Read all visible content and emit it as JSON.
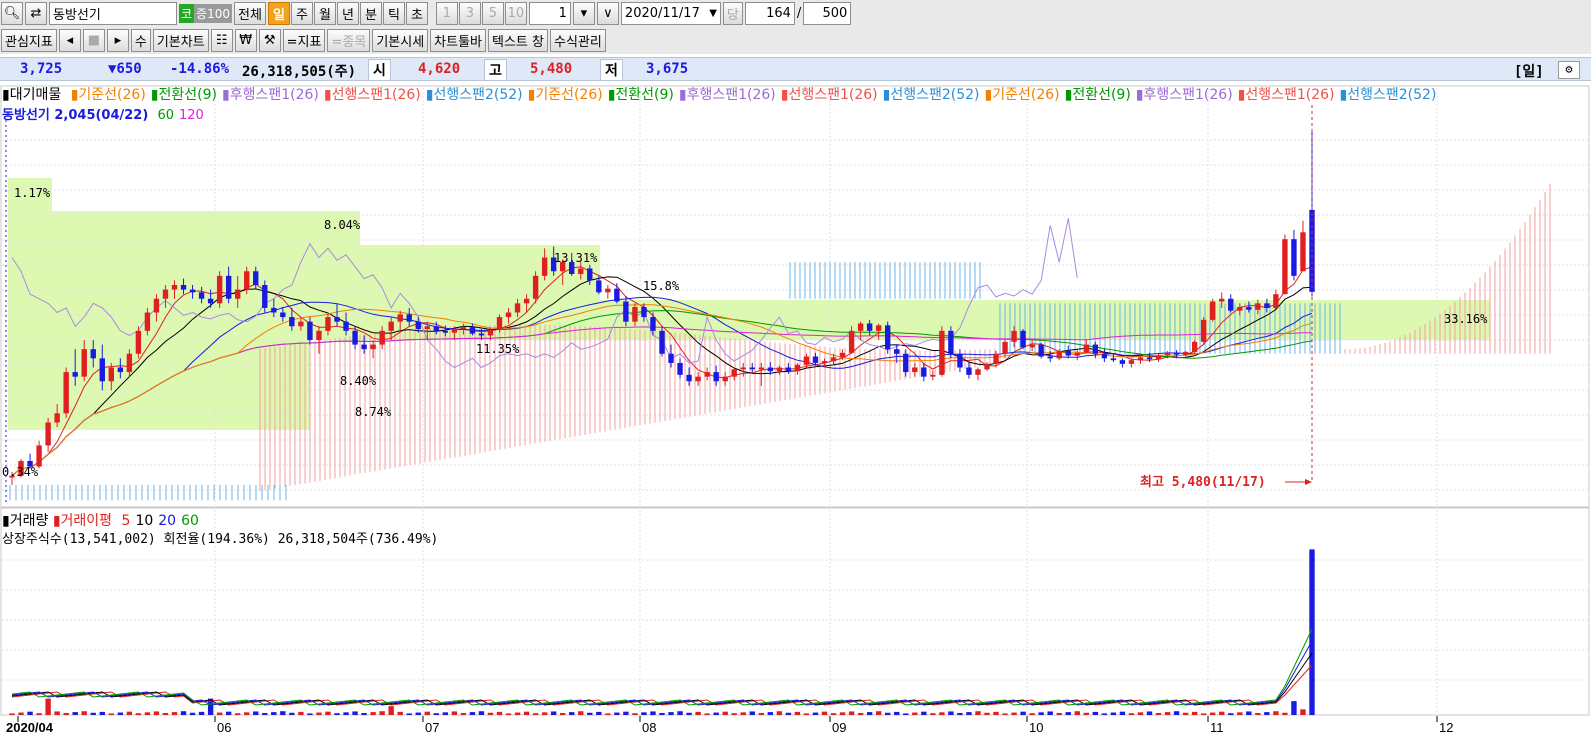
{
  "toolbar1": {
    "stock_name": "동방선기",
    "market_badge": "코",
    "margin_badge": "증100",
    "all_button": "전체",
    "periods": [
      "일",
      "주",
      "월",
      "년",
      "분",
      "틱",
      "초"
    ],
    "period_selected": "일",
    "intervals": [
      "1",
      "3",
      "5",
      "10"
    ],
    "interval_value": "1",
    "date": "2020/11/17",
    "current_button": "당",
    "count_value": "164",
    "slash": "/",
    "total_value": "500"
  },
  "toolbar2": {
    "watchlist": "관심지표",
    "su": "수",
    "basic_chart": "기본차트",
    "won": "₩",
    "indicator": "=지표",
    "item": "=종목",
    "basic_quote": "기본시세",
    "chart_toolbar": "차트툴바",
    "text_window": "텍스트 창",
    "formula_mgmt": "수식관리"
  },
  "infobar": {
    "price": "3,725",
    "change": "▼650",
    "change_rate": "-14.86%",
    "volume": "26,318,505(주)",
    "open_label": "시",
    "open": "4,620",
    "high_label": "고",
    "high": "5,480",
    "low_label": "저",
    "low": "3,675",
    "period_label": "[일]"
  },
  "legend": {
    "title": "대기매물",
    "items": [
      {
        "text": "기준선(26)",
        "color": "#f47f00"
      },
      {
        "text": "전환선(9)",
        "color": "#009a00"
      },
      {
        "text": "후행스팬1(26)",
        "color": "#9b6bd6"
      },
      {
        "text": "선행스팬1(26)",
        "color": "#f0504a"
      },
      {
        "text": "선행스팬2(52)",
        "color": "#2a8fd8"
      },
      {
        "text": "기준선(26)",
        "color": "#f47f00"
      },
      {
        "text": "전환선(9)",
        "color": "#009a00"
      },
      {
        "text": "후행스팬1(26)",
        "color": "#9b6bd6"
      },
      {
        "text": "선행스팬1(26)",
        "color": "#f0504a"
      },
      {
        "text": "선행스팬2(52)",
        "color": "#2a8fd8"
      },
      {
        "text": "기준선(26)",
        "color": "#f47f00"
      },
      {
        "text": "전환선(9)",
        "color": "#009a00"
      },
      {
        "text": "후행스팬1(26)",
        "color": "#9b6bd6"
      },
      {
        "text": "선행스팬1(26)",
        "color": "#f0504a"
      },
      {
        "text": "선행스팬2(52)",
        "color": "#2a8fd8"
      }
    ],
    "ma_text": "동방선기 2,045(04/22)",
    "ma_items": [
      {
        "text": "60",
        "color": "#009a00"
      },
      {
        "text": "120",
        "color": "#e020e0"
      }
    ]
  },
  "volume_legend": {
    "title": "거래량",
    "ma_title": "거래이평",
    "ma_items": [
      {
        "text": "5",
        "color": "#e02020"
      },
      {
        "text": "10",
        "color": "#000000"
      },
      {
        "text": "20",
        "color": "#1a1ae0"
      },
      {
        "text": "60",
        "color": "#009a00"
      }
    ],
    "info": "상장주식수(13,541,002) 회전율(194.36%) 26,318,504주(736.49%)"
  },
  "chart_data": {
    "type": "candlestick",
    "price_axis": {
      "min": 1400,
      "max": 5600
    },
    "volume_axis": {
      "min": 0,
      "max": 27000000
    },
    "months": [
      "2020/04",
      "06",
      "07",
      "08",
      "09",
      "10",
      "11",
      "12"
    ],
    "candles": [
      {
        "o": 1700,
        "h": 1760,
        "l": 1620,
        "c": 1720
      },
      {
        "o": 1720,
        "h": 1900,
        "l": 1700,
        "c": 1880
      },
      {
        "o": 1880,
        "h": 1960,
        "l": 1800,
        "c": 1820
      },
      {
        "o": 1820,
        "h": 2100,
        "l": 1800,
        "c": 2050
      },
      {
        "o": 2050,
        "h": 2350,
        "l": 1980,
        "c": 2300
      },
      {
        "o": 2300,
        "h": 2500,
        "l": 2250,
        "c": 2400
      },
      {
        "o": 2400,
        "h": 2900,
        "l": 2350,
        "c": 2850
      },
      {
        "o": 2850,
        "h": 3100,
        "l": 2700,
        "c": 2800
      },
      {
        "o": 2800,
        "h": 3200,
        "l": 2750,
        "c": 3100
      },
      {
        "o": 3100,
        "h": 3200,
        "l": 2900,
        "c": 3000
      },
      {
        "o": 3000,
        "h": 3150,
        "l": 2650,
        "c": 2750
      },
      {
        "o": 2750,
        "h": 2950,
        "l": 2650,
        "c": 2900
      },
      {
        "o": 2900,
        "h": 3000,
        "l": 2780,
        "c": 2850
      },
      {
        "o": 2850,
        "h": 3100,
        "l": 2800,
        "c": 3050
      },
      {
        "o": 3050,
        "h": 3350,
        "l": 3000,
        "c": 3300
      },
      {
        "o": 3300,
        "h": 3550,
        "l": 3250,
        "c": 3500
      },
      {
        "o": 3500,
        "h": 3700,
        "l": 3400,
        "c": 3650
      },
      {
        "o": 3650,
        "h": 3800,
        "l": 3550,
        "c": 3750
      },
      {
        "o": 3750,
        "h": 3850,
        "l": 3650,
        "c": 3800
      },
      {
        "o": 3800,
        "h": 3870,
        "l": 3700,
        "c": 3750
      },
      {
        "o": 3750,
        "h": 3800,
        "l": 3650,
        "c": 3720
      },
      {
        "o": 3720,
        "h": 3780,
        "l": 3600,
        "c": 3650
      },
      {
        "o": 3650,
        "h": 3750,
        "l": 3550,
        "c": 3600
      },
      {
        "o": 3600,
        "h": 3950,
        "l": 3550,
        "c": 3900
      },
      {
        "o": 3900,
        "h": 4000,
        "l": 3600,
        "c": 3650
      },
      {
        "o": 3650,
        "h": 3900,
        "l": 3550,
        "c": 3750
      },
      {
        "o": 3750,
        "h": 4000,
        "l": 3700,
        "c": 3950
      },
      {
        "o": 3950,
        "h": 4000,
        "l": 3750,
        "c": 3800
      },
      {
        "o": 3800,
        "h": 3850,
        "l": 3500,
        "c": 3550
      },
      {
        "o": 3550,
        "h": 3650,
        "l": 3450,
        "c": 3500
      },
      {
        "o": 3500,
        "h": 3560,
        "l": 3400,
        "c": 3450
      },
      {
        "o": 3450,
        "h": 3550,
        "l": 3300,
        "c": 3350
      },
      {
        "o": 3350,
        "h": 3450,
        "l": 3300,
        "c": 3400
      },
      {
        "o": 3400,
        "h": 3450,
        "l": 3150,
        "c": 3200
      },
      {
        "o": 3200,
        "h": 3350,
        "l": 3050,
        "c": 3300
      },
      {
        "o": 3300,
        "h": 3500,
        "l": 3250,
        "c": 3450
      },
      {
        "o": 3450,
        "h": 3600,
        "l": 3350,
        "c": 3400
      },
      {
        "o": 3400,
        "h": 3500,
        "l": 3250,
        "c": 3300
      },
      {
        "o": 3300,
        "h": 3350,
        "l": 3100,
        "c": 3150
      },
      {
        "o": 3150,
        "h": 3250,
        "l": 3050,
        "c": 3100
      },
      {
        "o": 3100,
        "h": 3200,
        "l": 3000,
        "c": 3150
      },
      {
        "o": 3150,
        "h": 3350,
        "l": 3100,
        "c": 3300
      },
      {
        "o": 3300,
        "h": 3450,
        "l": 3200,
        "c": 3400
      },
      {
        "o": 3400,
        "h": 3520,
        "l": 3300,
        "c": 3480
      },
      {
        "o": 3480,
        "h": 3550,
        "l": 3350,
        "c": 3400
      },
      {
        "o": 3400,
        "h": 3450,
        "l": 3280,
        "c": 3320
      },
      {
        "o": 3320,
        "h": 3400,
        "l": 3200,
        "c": 3350
      },
      {
        "o": 3350,
        "h": 3400,
        "l": 3260,
        "c": 3300
      },
      {
        "o": 3300,
        "h": 3360,
        "l": 3240,
        "c": 3280
      },
      {
        "o": 3280,
        "h": 3350,
        "l": 3200,
        "c": 3320
      },
      {
        "o": 3320,
        "h": 3380,
        "l": 3260,
        "c": 3340
      },
      {
        "o": 3340,
        "h": 3380,
        "l": 3250,
        "c": 3270
      },
      {
        "o": 3270,
        "h": 3320,
        "l": 3200,
        "c": 3250
      },
      {
        "o": 3250,
        "h": 3330,
        "l": 3200,
        "c": 3310
      },
      {
        "o": 3310,
        "h": 3480,
        "l": 3280,
        "c": 3450
      },
      {
        "o": 3450,
        "h": 3550,
        "l": 3380,
        "c": 3500
      },
      {
        "o": 3500,
        "h": 3650,
        "l": 3450,
        "c": 3600
      },
      {
        "o": 3600,
        "h": 3700,
        "l": 3500,
        "c": 3650
      },
      {
        "o": 3650,
        "h": 3950,
        "l": 3600,
        "c": 3900
      },
      {
        "o": 3900,
        "h": 4200,
        "l": 3850,
        "c": 4100
      },
      {
        "o": 4100,
        "h": 4220,
        "l": 3900,
        "c": 3950
      },
      {
        "o": 3950,
        "h": 4080,
        "l": 3800,
        "c": 4050
      },
      {
        "o": 4050,
        "h": 4150,
        "l": 3900,
        "c": 3920
      },
      {
        "o": 3920,
        "h": 4050,
        "l": 3860,
        "c": 3980
      },
      {
        "o": 3980,
        "h": 4020,
        "l": 3800,
        "c": 3850
      },
      {
        "o": 3850,
        "h": 3900,
        "l": 3700,
        "c": 3720
      },
      {
        "o": 3720,
        "h": 3800,
        "l": 3650,
        "c": 3760
      },
      {
        "o": 3760,
        "h": 3820,
        "l": 3600,
        "c": 3620
      },
      {
        "o": 3620,
        "h": 3680,
        "l": 3350,
        "c": 3400
      },
      {
        "o": 3400,
        "h": 3600,
        "l": 3350,
        "c": 3560
      },
      {
        "o": 3560,
        "h": 3600,
        "l": 3400,
        "c": 3450
      },
      {
        "o": 3450,
        "h": 3500,
        "l": 3250,
        "c": 3300
      },
      {
        "o": 3300,
        "h": 3350,
        "l": 3020,
        "c": 3050
      },
      {
        "o": 3050,
        "h": 3150,
        "l": 2900,
        "c": 2950
      },
      {
        "o": 2950,
        "h": 3000,
        "l": 2780,
        "c": 2820
      },
      {
        "o": 2820,
        "h": 2900,
        "l": 2700,
        "c": 2750
      },
      {
        "o": 2750,
        "h": 2850,
        "l": 2700,
        "c": 2800
      },
      {
        "o": 2800,
        "h": 2900,
        "l": 2760,
        "c": 2850
      },
      {
        "o": 2850,
        "h": 2920,
        "l": 2700,
        "c": 2750
      },
      {
        "o": 2750,
        "h": 2850,
        "l": 2700,
        "c": 2800
      },
      {
        "o": 2800,
        "h": 2900,
        "l": 2760,
        "c": 2880
      },
      {
        "o": 2880,
        "h": 2950,
        "l": 2800,
        "c": 2900
      },
      {
        "o": 2900,
        "h": 2950,
        "l": 2850,
        "c": 2880
      },
      {
        "o": 2880,
        "h": 2950,
        "l": 2700,
        "c": 2900
      },
      {
        "o": 2900,
        "h": 2960,
        "l": 2820,
        "c": 2860
      },
      {
        "o": 2860,
        "h": 2920,
        "l": 2820,
        "c": 2900
      },
      {
        "o": 2900,
        "h": 2950,
        "l": 2830,
        "c": 2860
      },
      {
        "o": 2860,
        "h": 2950,
        "l": 2820,
        "c": 2930
      },
      {
        "o": 2930,
        "h": 3050,
        "l": 2900,
        "c": 3020
      },
      {
        "o": 3020,
        "h": 3060,
        "l": 2920,
        "c": 2950
      },
      {
        "o": 2950,
        "h": 3000,
        "l": 2900,
        "c": 2970
      },
      {
        "o": 2970,
        "h": 3050,
        "l": 2930,
        "c": 3010
      },
      {
        "o": 3010,
        "h": 3100,
        "l": 2980,
        "c": 3060
      },
      {
        "o": 3060,
        "h": 3350,
        "l": 3050,
        "c": 3300
      },
      {
        "o": 3300,
        "h": 3400,
        "l": 3200,
        "c": 3380
      },
      {
        "o": 3380,
        "h": 3420,
        "l": 3250,
        "c": 3300
      },
      {
        "o": 3300,
        "h": 3380,
        "l": 3200,
        "c": 3360
      },
      {
        "o": 3360,
        "h": 3400,
        "l": 3050,
        "c": 3100
      },
      {
        "o": 3100,
        "h": 3150,
        "l": 2950,
        "c": 3050
      },
      {
        "o": 3050,
        "h": 3100,
        "l": 2800,
        "c": 2850
      },
      {
        "o": 2850,
        "h": 2950,
        "l": 2800,
        "c": 2900
      },
      {
        "o": 2900,
        "h": 2950,
        "l": 2750,
        "c": 2800
      },
      {
        "o": 2800,
        "h": 2870,
        "l": 2760,
        "c": 2820
      },
      {
        "o": 2820,
        "h": 3350,
        "l": 2800,
        "c": 3300
      },
      {
        "o": 3300,
        "h": 3350,
        "l": 3000,
        "c": 3050
      },
      {
        "o": 3050,
        "h": 3100,
        "l": 2850,
        "c": 2900
      },
      {
        "o": 2900,
        "h": 2960,
        "l": 2780,
        "c": 2820
      },
      {
        "o": 2820,
        "h": 2900,
        "l": 2760,
        "c": 2880
      },
      {
        "o": 2880,
        "h": 2960,
        "l": 2860,
        "c": 2940
      },
      {
        "o": 2940,
        "h": 3080,
        "l": 2900,
        "c": 3050
      },
      {
        "o": 3050,
        "h": 3200,
        "l": 3000,
        "c": 3180
      },
      {
        "o": 3180,
        "h": 3350,
        "l": 3120,
        "c": 3300
      },
      {
        "o": 3300,
        "h": 3320,
        "l": 3100,
        "c": 3120
      },
      {
        "o": 3120,
        "h": 3200,
        "l": 3080,
        "c": 3150
      },
      {
        "o": 3150,
        "h": 3170,
        "l": 3000,
        "c": 3020
      },
      {
        "o": 3020,
        "h": 3080,
        "l": 2960,
        "c": 3000
      },
      {
        "o": 3000,
        "h": 3100,
        "l": 2980,
        "c": 3080
      },
      {
        "o": 3080,
        "h": 3140,
        "l": 3000,
        "c": 3030
      },
      {
        "o": 3030,
        "h": 3100,
        "l": 2980,
        "c": 3060
      },
      {
        "o": 3060,
        "h": 3200,
        "l": 3050,
        "c": 3150
      },
      {
        "o": 3150,
        "h": 3180,
        "l": 3000,
        "c": 3050
      },
      {
        "o": 3050,
        "h": 3100,
        "l": 2960,
        "c": 3000
      },
      {
        "o": 3000,
        "h": 3050,
        "l": 2960,
        "c": 2980
      },
      {
        "o": 2980,
        "h": 3000,
        "l": 2900,
        "c": 2940
      },
      {
        "o": 2940,
        "h": 3000,
        "l": 2900,
        "c": 2980
      },
      {
        "o": 2980,
        "h": 3040,
        "l": 2940,
        "c": 3010
      },
      {
        "o": 3010,
        "h": 3060,
        "l": 2960,
        "c": 2990
      },
      {
        "o": 2990,
        "h": 3050,
        "l": 2960,
        "c": 3030
      },
      {
        "o": 3030,
        "h": 3080,
        "l": 3000,
        "c": 3060
      },
      {
        "o": 3060,
        "h": 3090,
        "l": 3000,
        "c": 3040
      },
      {
        "o": 3040,
        "h": 3080,
        "l": 3000,
        "c": 3070
      },
      {
        "o": 3070,
        "h": 3200,
        "l": 3050,
        "c": 3180
      },
      {
        "o": 3180,
        "h": 3450,
        "l": 3160,
        "c": 3420
      },
      {
        "o": 3420,
        "h": 3650,
        "l": 3400,
        "c": 3620
      },
      {
        "o": 3620,
        "h": 3720,
        "l": 3550,
        "c": 3650
      },
      {
        "o": 3650,
        "h": 3700,
        "l": 3500,
        "c": 3520
      },
      {
        "o": 3520,
        "h": 3600,
        "l": 3470,
        "c": 3560
      },
      {
        "o": 3560,
        "h": 3620,
        "l": 3500,
        "c": 3530
      },
      {
        "o": 3530,
        "h": 3640,
        "l": 3480,
        "c": 3600
      },
      {
        "o": 3600,
        "h": 3650,
        "l": 3500,
        "c": 3550
      },
      {
        "o": 3550,
        "h": 3750,
        "l": 3540,
        "c": 3700
      },
      {
        "o": 3700,
        "h": 4350,
        "l": 3700,
        "c": 4300
      },
      {
        "o": 4300,
        "h": 4400,
        "l": 3850,
        "c": 3900
      },
      {
        "o": 3950,
        "h": 4500,
        "l": 3950,
        "c": 4375
      },
      {
        "o": 4620,
        "h": 5480,
        "l": 3675,
        "c": 3725
      }
    ],
    "volume_spikes_millions": [
      {
        "month": "04",
        "value": 2.6
      },
      {
        "month": "05",
        "value": 2.6
      },
      {
        "month": "06",
        "value": 1.4
      },
      {
        "month": "11",
        "value": 2.2
      },
      {
        "month": "11",
        "value": 26.3
      }
    ],
    "cloud_band": {
      "from": 3150,
      "to": 3600
    },
    "supply_zones": [
      {
        "label": "1.17%"
      },
      {
        "label": "8.04%"
      },
      {
        "label": "13.31%"
      },
      {
        "label": "11.35%"
      },
      {
        "label": "8.40%"
      },
      {
        "label": "8.74%"
      },
      {
        "label": "0.34%"
      },
      {
        "label": "33.16%"
      }
    ],
    "annotations": {
      "high_marker": "최고 5,480(11/17)",
      "mid_label": "15.8%"
    }
  }
}
